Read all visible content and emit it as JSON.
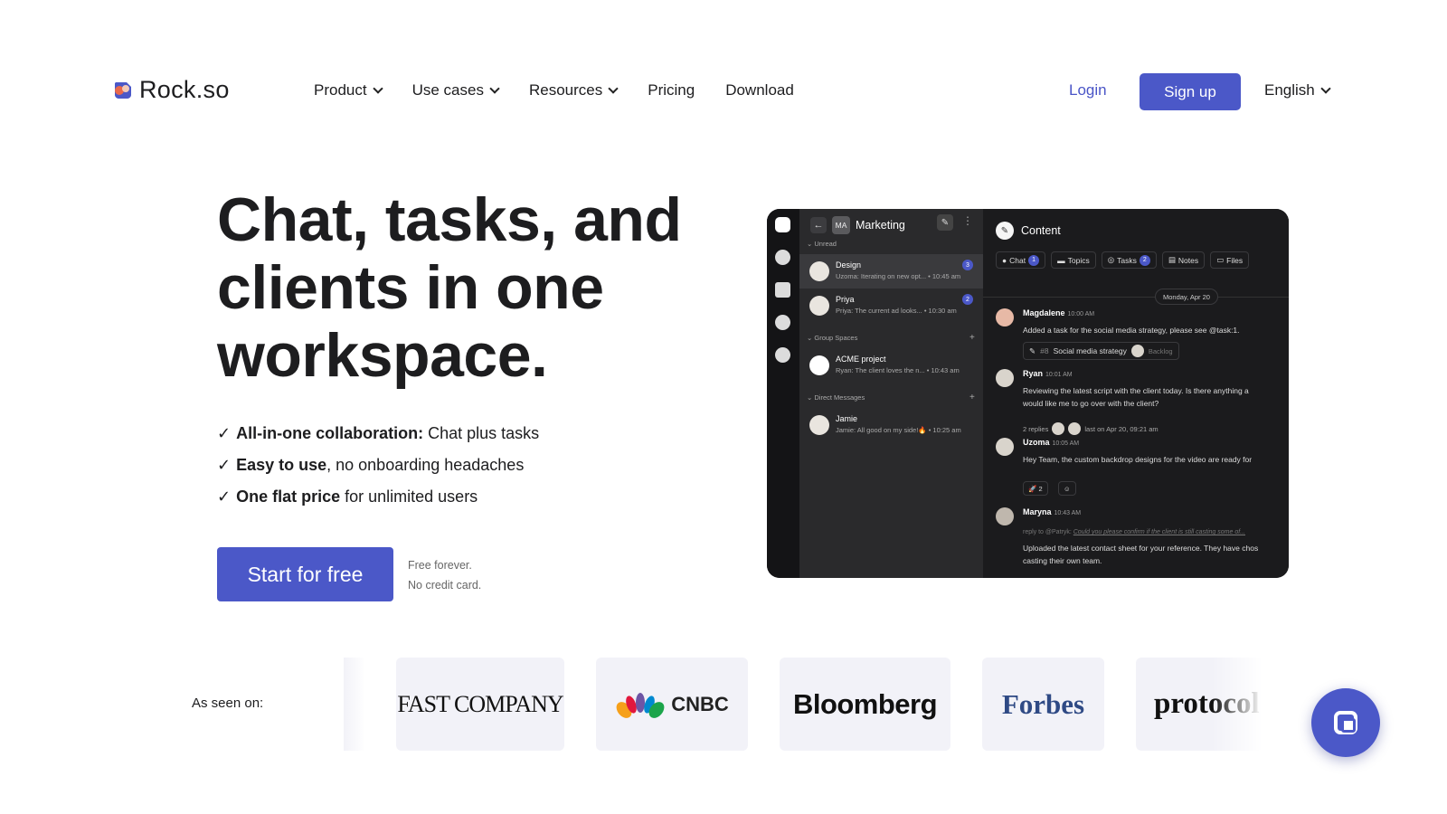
{
  "brand": {
    "name": "Rock.so"
  },
  "nav": {
    "items": [
      {
        "label": "Product",
        "dropdown": true
      },
      {
        "label": "Use cases",
        "dropdown": true
      },
      {
        "label": "Resources",
        "dropdown": true
      },
      {
        "label": "Pricing",
        "dropdown": false
      },
      {
        "label": "Download",
        "dropdown": false
      }
    ],
    "login": "Login",
    "signup": "Sign up",
    "language": "English"
  },
  "hero": {
    "title": "Chat, tasks, and clients in one workspace.",
    "check": "✓",
    "features": [
      {
        "bold": "All-in-one collaboration:",
        "rest": " Chat plus tasks"
      },
      {
        "bold": "Easy to use",
        "rest": ", no onboarding headaches"
      },
      {
        "bold": "One flat price",
        "rest": " for unlimited users"
      }
    ],
    "cta": "Start for free",
    "note1": "Free forever.",
    "note2": "No credit card."
  },
  "app": {
    "space_badge": "MA",
    "space": "Marketing",
    "sections": {
      "unread": "Unread",
      "group": "Group Spaces",
      "direct": "Direct Messages"
    },
    "conversations": [
      {
        "name": "Design",
        "preview": "Uzoma: Iterating on new opt... • 10:45 am",
        "badge": "3"
      },
      {
        "name": "Priya",
        "preview": "Priya: The current ad looks... • 10:30 am",
        "badge": "2"
      },
      {
        "name": "ACME project",
        "preview": "Ryan: The client loves the n... • 10:43 am",
        "badge": ""
      },
      {
        "name": "Jamie",
        "preview": "Jamie: All good on my side!🔥 • 10:25 am",
        "badge": ""
      }
    ],
    "channel": "Content",
    "tabs": [
      {
        "label": "Chat",
        "badge": "1"
      },
      {
        "label": "Topics",
        "badge": ""
      },
      {
        "label": "Tasks",
        "badge": "2"
      },
      {
        "label": "Notes",
        "badge": ""
      },
      {
        "label": "Files",
        "badge": ""
      }
    ],
    "date": "Monday, Apr 20",
    "messages": [
      {
        "author": "Magdalene",
        "time": "10:00 AM",
        "text": "Added a task for the social media strategy, please see @task:1."
      },
      {
        "author": "Ryan",
        "time": "10:01 AM",
        "text": "Reviewing the latest script with the client today. Is there anything a",
        "text2": "would like me to go over with the client?"
      },
      {
        "author": "Uzoma",
        "time": "10:05 AM",
        "text": "Hey Team, the custom backdrop designs for the video are ready for"
      },
      {
        "author": "Maryna",
        "time": "10:43 AM",
        "text": "Uploaded the latest contact sheet for your reference. They have chos",
        "text2": "casting their own team."
      }
    ],
    "task_chip": {
      "tag": "#8",
      "title": "Social media strategy",
      "status": "Backlog"
    },
    "replies": {
      "count": "2 replies",
      "last": "last on Apr 20, 09:21 am"
    },
    "reaction": {
      "emoji": "🚀",
      "count": "2"
    },
    "reply_to": {
      "prefix": "reply to @Patryk:",
      "quote": "Could you please confirm if the client is still casting some of..."
    }
  },
  "press": {
    "label": "As seen on:",
    "logos": [
      "FAST COMPANY",
      "CNBC",
      "Bloomberg",
      "Forbes",
      "protocol"
    ]
  },
  "colors": {
    "accent": "#4b58c8",
    "link": "#4a55c7",
    "press_bg": "#f2f2f8"
  }
}
